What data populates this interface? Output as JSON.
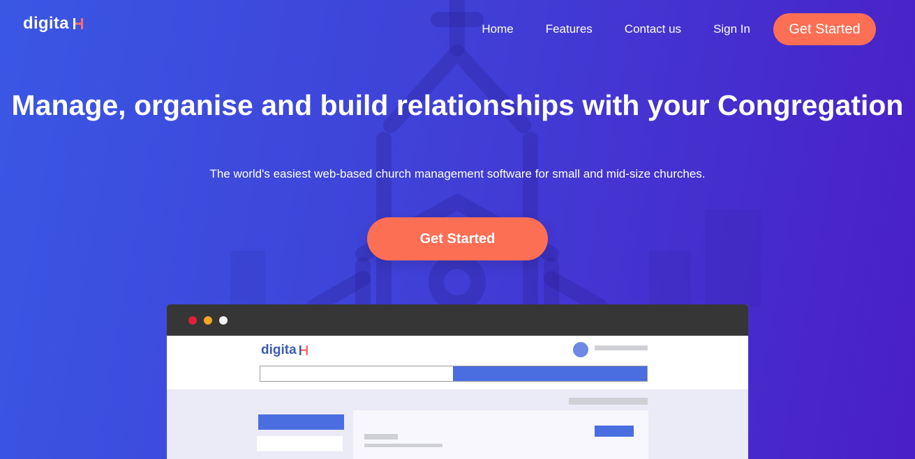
{
  "brand": {
    "logo_text": "digita",
    "accent_color": "#fd6f55",
    "mark_left_color": "#ffffff",
    "mark_right_color": "#ff6b6b"
  },
  "nav": {
    "items": [
      "Home",
      "Features",
      "Contact us",
      "Sign In"
    ],
    "cta": "Get Started"
  },
  "hero": {
    "title": "Manage, organise and build relationships with your Congregation",
    "subtitle": "The world's easiest web-based church management software for small and mid-size churches.",
    "cta": "Get Started"
  },
  "mockup": {
    "logo_text": "digita",
    "window_dots": [
      "#e0203c",
      "#f5a623",
      "#f3f3f3"
    ],
    "primary_color": "#4a6de0"
  }
}
